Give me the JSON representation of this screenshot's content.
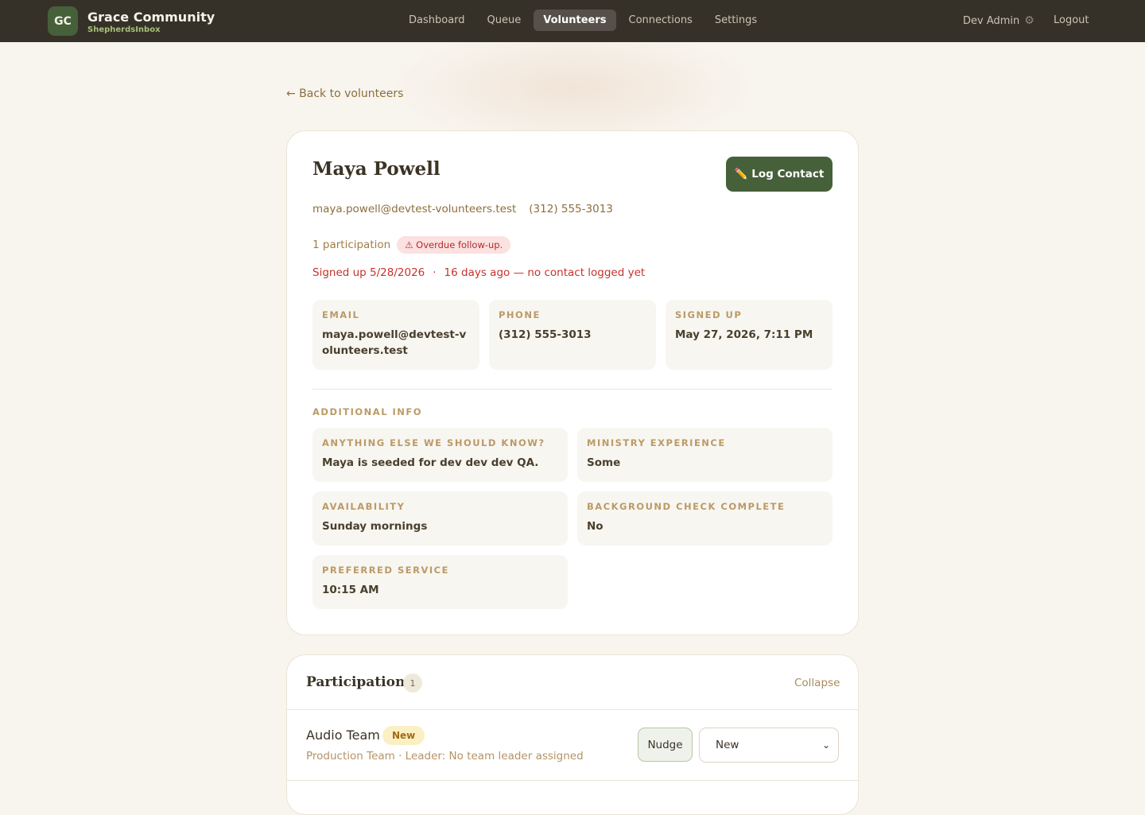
{
  "header": {
    "logo_initials": "GC",
    "org_name": "Grace Community",
    "app_name": "ShepherdsInbox",
    "nav": [
      {
        "label": "Dashboard",
        "active": false
      },
      {
        "label": "Queue",
        "active": false
      },
      {
        "label": "Volunteers",
        "active": true
      },
      {
        "label": "Connections",
        "active": false
      },
      {
        "label": "Settings",
        "active": false
      }
    ],
    "user_name": "Dev Admin",
    "user_icon": "gear-icon",
    "logout_label": "Logout"
  },
  "back_link": "← Back to volunteers",
  "volunteer": {
    "name": "Maya Powell",
    "log_contact_label": "✏️ Log Contact",
    "email": "maya.powell@devtest-volunteers.test",
    "phone": "(312) 555-3013",
    "participation_count_text": "1 participation",
    "overdue_badge": "⚠ Overdue follow-up.",
    "signed_up_short": "Signed up 5/28/2026",
    "separator": "·",
    "no_contact_text": "16 days ago — no contact logged yet",
    "details": [
      {
        "label": "EMAIL",
        "value": "maya.powell@devtest-volunteers.test"
      },
      {
        "label": "PHONE",
        "value": "(312) 555-3013"
      },
      {
        "label": "SIGNED UP",
        "value": "May 27, 2026, 7:11 PM"
      }
    ],
    "additional_info_title": "ADDITIONAL INFO",
    "additional_info": [
      {
        "label": "ANYTHING ELSE WE SHOULD KNOW?",
        "value": "Maya is seeded for dev dev dev QA."
      },
      {
        "label": "MINISTRY EXPERIENCE",
        "value": "Some"
      },
      {
        "label": "AVAILABILITY",
        "value": "Sunday mornings"
      },
      {
        "label": "BACKGROUND CHECK COMPLETE",
        "value": "No"
      },
      {
        "label": "PREFERRED SERVICE",
        "value": "10:15 AM"
      }
    ]
  },
  "participation": {
    "title": "Participation",
    "count": "1",
    "collapse_label": "Collapse",
    "items": [
      {
        "team": "Audio Team",
        "badge": "New",
        "meta": "Production Team · Leader: No team leader assigned",
        "nudge_label": "Nudge",
        "status_value": "New"
      }
    ]
  }
}
